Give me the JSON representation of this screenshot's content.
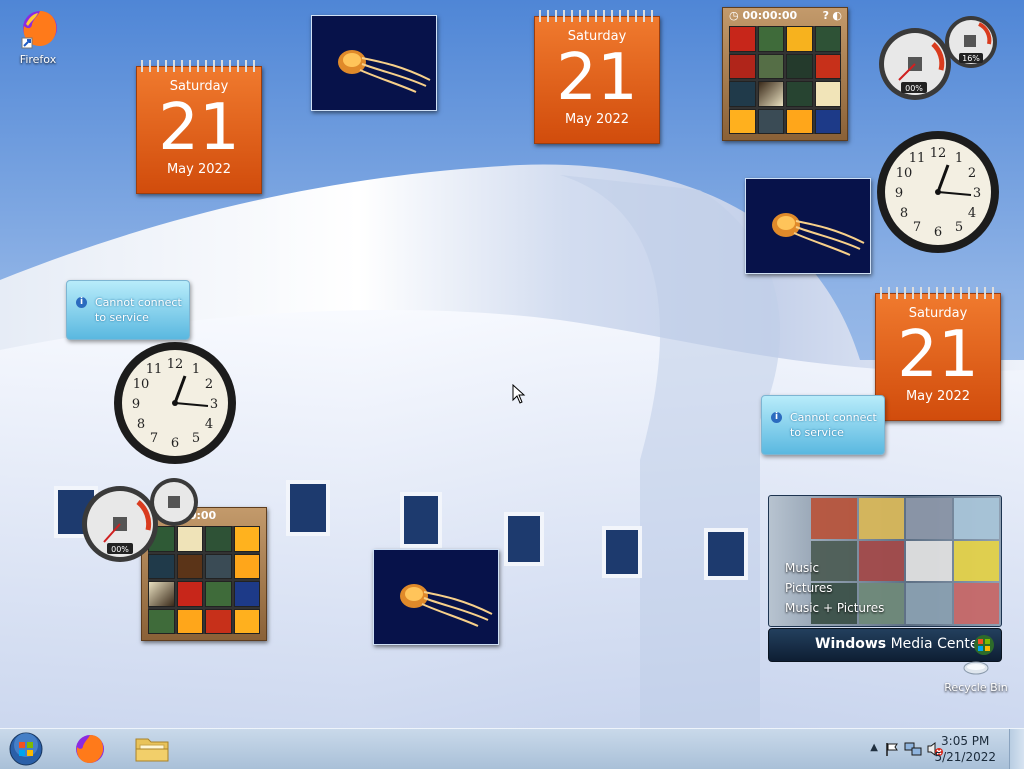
{
  "desktop": {
    "icons": [
      {
        "label": "Firefox"
      },
      {
        "label": "Recycle Bin"
      }
    ]
  },
  "calendars": [
    {
      "dow": "Saturday",
      "day": "21",
      "month_year": "May 2022"
    },
    {
      "dow": "Saturday",
      "day": "21",
      "month_year": "May 2022"
    },
    {
      "dow": "Saturday",
      "day": "21",
      "month_year": "May 2022"
    }
  ],
  "puzzles": [
    {
      "timer": "00:00:00"
    },
    {
      "timer": "00:00:00"
    }
  ],
  "notices": [
    {
      "line1": "Cannot connect",
      "line2": "to service"
    },
    {
      "line1": "Cannot connect",
      "line2": "to service"
    }
  ],
  "meters": [
    {
      "cpu": "00%",
      "mem": "16%"
    },
    {
      "cpu": "00%"
    }
  ],
  "clocks": [
    {
      "numbers": [
        "12",
        "1",
        "2",
        "3",
        "4",
        "5",
        "6",
        "7",
        "8",
        "9",
        "10",
        "11"
      ]
    },
    {
      "numbers": [
        "12",
        "1",
        "2",
        "3",
        "4",
        "5",
        "6",
        "7",
        "8",
        "9",
        "10",
        "11"
      ]
    }
  ],
  "media_center": {
    "menu": [
      "Music",
      "Pictures",
      "Music + Pictures"
    ],
    "brand_bold": "Windows",
    "brand_rest": " Media Center"
  },
  "taskbar": {
    "time": "3:05 PM",
    "date": "5/21/2022"
  },
  "colors": {
    "calendar": "#e8621e",
    "taskbar": "#b8cde3",
    "notice": "#7fcbea"
  }
}
